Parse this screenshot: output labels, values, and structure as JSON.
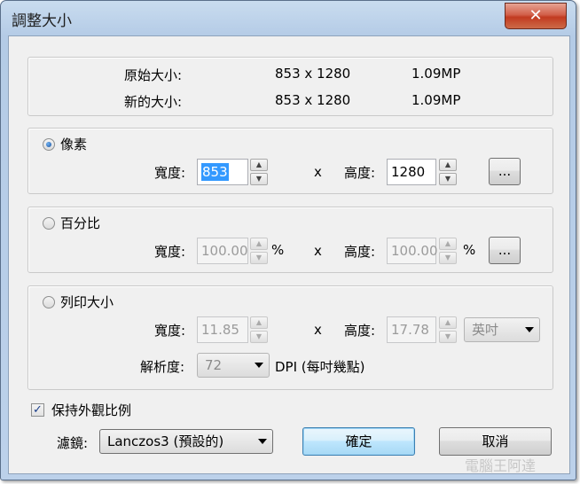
{
  "window": {
    "title": "調整大小",
    "close_glyph": "✕"
  },
  "info": {
    "original_label": "原始大小:",
    "original_dims": "853 x 1280",
    "original_mp": "1.09MP",
    "new_label": "新的大小:",
    "new_dims": "853 x 1280",
    "new_mp": "1.09MP"
  },
  "pixels": {
    "label": "像素",
    "selected": true,
    "width_label": "寬度:",
    "width_value": "853",
    "x": "x",
    "height_label": "高度:",
    "height_value": "1280",
    "more_button": "..."
  },
  "percent": {
    "label": "百分比",
    "width_label": "寬度:",
    "width_value": "100.00",
    "unit1": "%",
    "x": "x",
    "height_label": "高度:",
    "height_value": "100.00",
    "unit2": "%",
    "more_button": "..."
  },
  "print": {
    "label": "列印大小",
    "width_label": "寬度:",
    "width_value": "11.85",
    "x": "x",
    "height_label": "高度:",
    "height_value": "17.78",
    "unit_selected": "英吋",
    "resolution_label": "解析度:",
    "resolution_value": "72",
    "dpi_label": "DPI (每吋幾點)"
  },
  "keep_aspect": {
    "label": "保持外觀比例",
    "checked": true,
    "check_glyph": "✓"
  },
  "filter": {
    "label": "濾鏡:",
    "selected": "Lanczos3 (預設的)"
  },
  "buttons": {
    "ok": "確定",
    "cancel": "取消"
  },
  "spin_glyphs": {
    "up": "▲",
    "down": "▼"
  },
  "watermark": "電腦王阿達",
  "colors": {
    "accent": "#3399ff",
    "close": "#c23b20",
    "window_frame": "#b4cbe6"
  }
}
